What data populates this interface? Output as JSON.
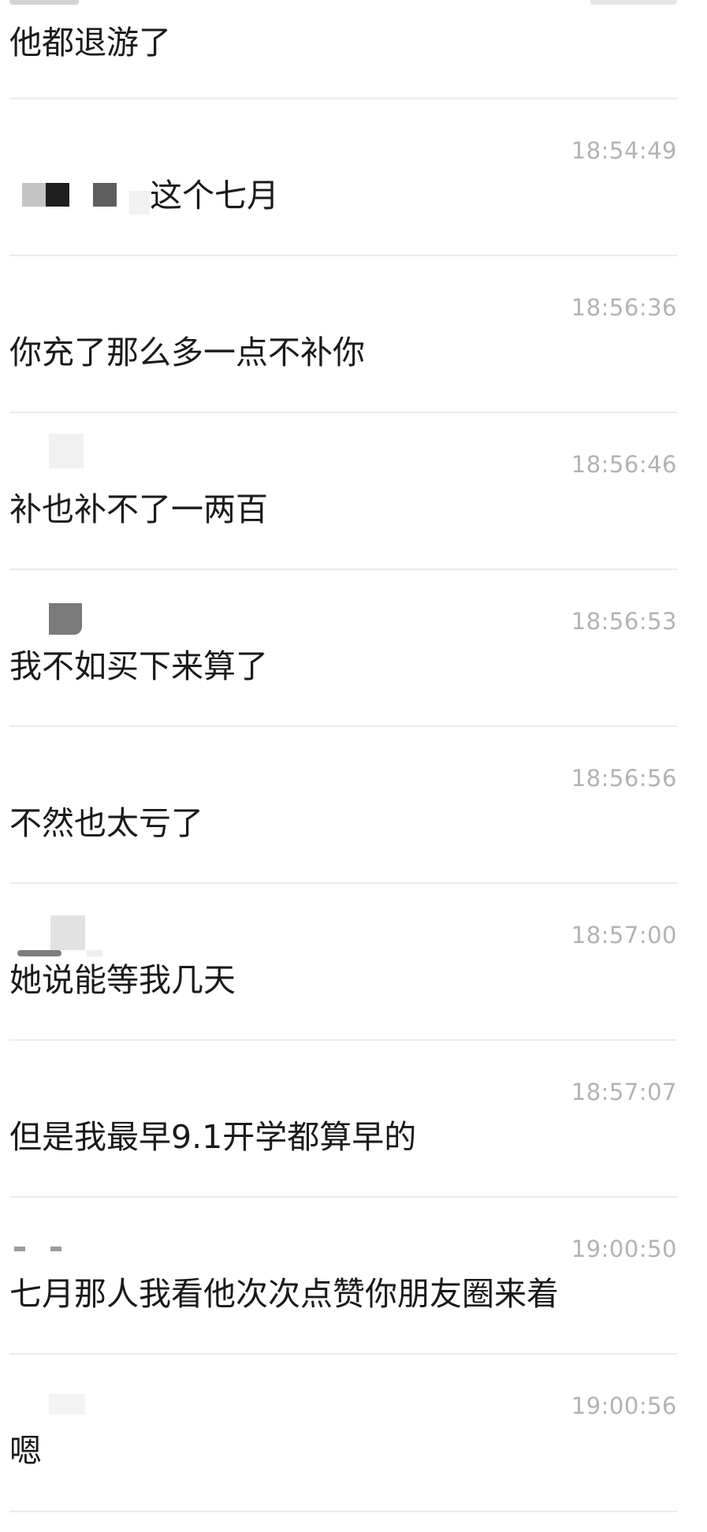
{
  "messages": [
    {
      "time": "",
      "text": "他都退游了"
    },
    {
      "time": "18:54:49",
      "text": "这个七月"
    },
    {
      "time": "18:56:36",
      "text": "你充了那么多一点不补你"
    },
    {
      "time": "18:56:46",
      "text": "补也补不了一两百"
    },
    {
      "time": "18:56:53",
      "text": "我不如买下来算了"
    },
    {
      "time": "18:56:56",
      "text": "不然也太亏了"
    },
    {
      "time": "18:57:00",
      "text": "她说能等我几天"
    },
    {
      "time": "18:57:07",
      "text": "但是我最早9.1开学都算早的"
    },
    {
      "time": "19:00:50",
      "text": "七月那人我看他次次点赞你朋友圈来着"
    },
    {
      "time": "19:00:56",
      "text": "嗯"
    }
  ],
  "colors": {
    "background": "#ffffff",
    "message_text": "#1a1a1a",
    "timestamp": "#b3b3b3",
    "divider": "#ececec"
  }
}
